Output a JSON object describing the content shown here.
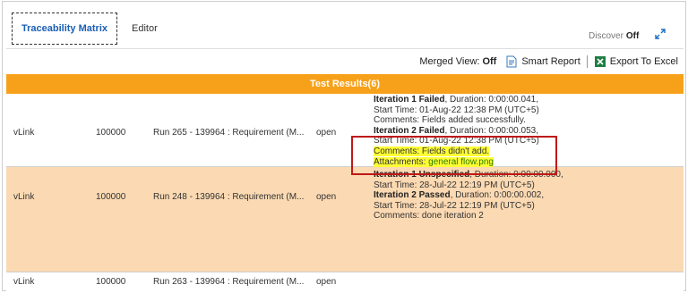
{
  "tabs": [
    {
      "label": "Traceability Matrix",
      "active": true
    },
    {
      "label": "Editor",
      "active": false
    }
  ],
  "discover": {
    "label": "Discover",
    "state": "Off"
  },
  "toolbar": {
    "merged_view_label": "Merged View:",
    "merged_view_value": "Off",
    "smart_report_label": "Smart Report",
    "export_label": "Export To Excel"
  },
  "results": {
    "header": "Test Results(6)",
    "rows": [
      {
        "name": "vLink",
        "id": "100000",
        "run": "Run 265 - 139964 : Requirement (M...",
        "status": "open",
        "details": {
          "l1_bold": "Iteration 1 Failed",
          "l1_rest": ", Duration: 0:00:00.041,",
          "l2": "Start Time: 01-Aug-22 12:38 PM (UTC+5)",
          "l3": "Comments: Fields added successfully.",
          "l4_bold": "Iteration 2 Failed",
          "l4_rest": ", Duration: 0:00:00.053,",
          "l5": "Start Time: 01-Aug-22 12:38 PM (UTC+5)",
          "l6": "Comments: Fields didn't add.",
          "l7_label": "Attachments: ",
          "l7_link": "general flow.png"
        }
      },
      {
        "name": "vLink",
        "id": "100000",
        "run": "Run 248 - 139964 : Requirement (M...",
        "status": "open",
        "details": {
          "l1_bold": "Iteration 1 Unspecified",
          "l1_rest": ", Duration: 0:00:00.000,",
          "l2": "Start Time: 28-Jul-22 12:19 PM (UTC+5)",
          "l3_bold": "Iteration 2 Passed",
          "l3_rest": ", Duration: 0:00:00.002,",
          "l4": "Start Time: 28-Jul-22 12:19 PM (UTC+5)",
          "l5": "Comments: done iteration 2"
        }
      },
      {
        "name": "vLink",
        "id": "100000",
        "run": "Run 263 - 139964 : Requirement (M...",
        "status": "open"
      }
    ]
  },
  "icons": {
    "expand": "expand-arrows-icon",
    "smart_report": "report-icon",
    "export": "excel-icon"
  },
  "colors": {
    "accent_orange": "#f7a11a",
    "row_highlight": "#fbd9b2",
    "tab_blue": "#1a5fb4",
    "annotation_red": "#c01818",
    "text_highlight": "#ffff35"
  }
}
